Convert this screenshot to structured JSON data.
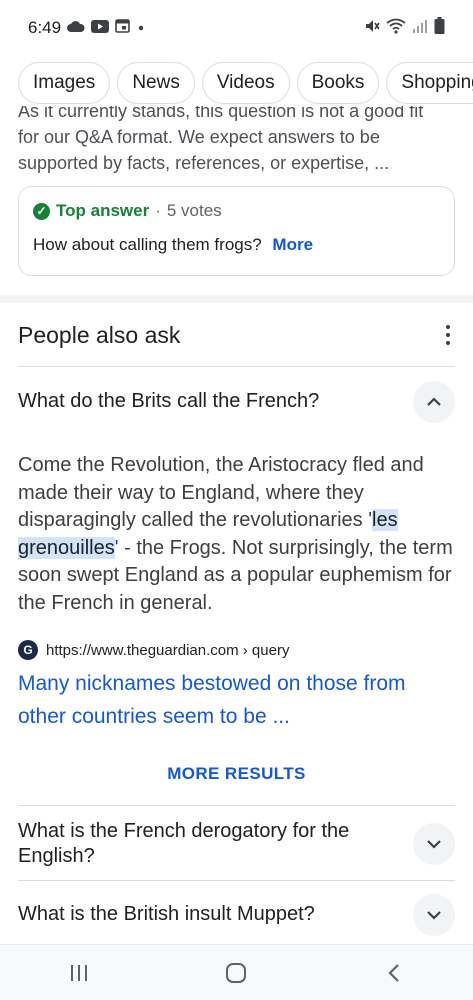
{
  "status_bar": {
    "time": "6:49",
    "left_icons": [
      "cloud-icon",
      "youtube-icon",
      "calendar-icon",
      "dot-icon"
    ],
    "right_icons": [
      "mute-icon",
      "wifi-icon",
      "signal-icon",
      "battery-icon"
    ]
  },
  "chips": [
    {
      "label": "Images"
    },
    {
      "label": "News"
    },
    {
      "label": "Videos"
    },
    {
      "label": "Books"
    },
    {
      "label": "Shopping"
    }
  ],
  "snippet": {
    "line1": "As it currently stands, this question is not a good fit",
    "line2": "for our Q&A format. We expect answers to be",
    "line3": "supported by facts, references, or expertise, ..."
  },
  "top_answer": {
    "label": "Top answer",
    "separator": "·",
    "votes": "5 votes",
    "text": "How about calling them frogs?",
    "more": "More",
    "accent": "#188038"
  },
  "paa": {
    "title": "People also ask",
    "expanded": {
      "question": "What do the Brits call the French?",
      "answer_part1": "Come the Revolution, the Aristocracy fled and made their way to England, where they disparagingly called the revolutionaries '",
      "answer_highlight": "les grenouilles",
      "answer_part2": "' - the Frogs. Not surprisingly, the term soon swept England as a popular euphemism for the French in general.",
      "source_url": "https://www.theguardian.com › query",
      "link_text": "Many nicknames bestowed on those from other countries seem to be ...",
      "more_results": "MORE RESULTS"
    },
    "collapsed": [
      {
        "question": "What is the French derogatory for the English?"
      },
      {
        "question": "What is the British insult Muppet?"
      }
    ]
  },
  "nav": {
    "icons": [
      "recent-apps-icon",
      "home-icon",
      "back-icon"
    ]
  },
  "colors": {
    "link": "#1558d6",
    "highlight": "#d2e3fc"
  }
}
